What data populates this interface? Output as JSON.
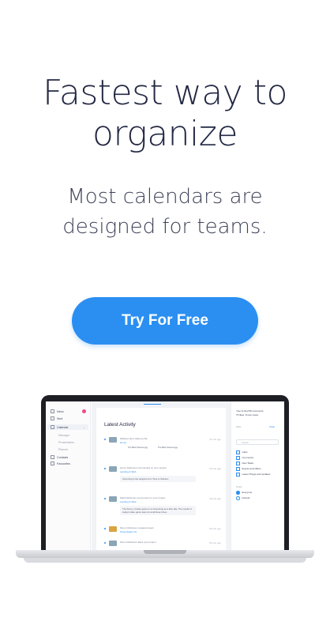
{
  "hero": {
    "title_line1": "Fastest way to",
    "title_line2": "organize",
    "subtitle_line1": "Most calendars are",
    "subtitle_line2": "designed for teams.",
    "cta_label": "Try For Free"
  },
  "colors": {
    "accent": "#2b8ff2",
    "heading": "#232843",
    "badge": "#ef4b86"
  },
  "device": {
    "sidebar": {
      "items": [
        {
          "label": "Inbox",
          "icon": "inbox-icon"
        },
        {
          "label": "Sent",
          "icon": "send-icon"
        },
        {
          "label": "Calendar",
          "icon": "calendar-icon"
        },
        {
          "label": "Manager",
          "sub": true
        },
        {
          "label": "Presentation",
          "sub": true
        },
        {
          "label": "Planner",
          "sub": true
        },
        {
          "label": "Contacts",
          "icon": "contacts-icon"
        },
        {
          "label": "Favourites",
          "icon": "star-icon"
        }
      ]
    },
    "main": {
      "title": "Latest Activity",
      "activities": [
        {
          "line": "Mathew Hine shared a file",
          "link": "Home",
          "time": "11 min ago",
          "files": [
            "The Best Screens.jpg",
            "The Best Screens.jpg"
          ]
        },
        {
          "line": "Henry Robinson commented on your project",
          "link": "Landing & Web",
          "time": "20 min ago",
          "comment": "According to the analysis from Time to Solution"
        },
        {
          "line": "Mark Robinson commented on your project",
          "link": "Landing & Web",
          "time": "40 min ago",
          "comment": "The theory of video game is so interesting as a fairy tale. The results of today's video game was not at all these times."
        },
        {
          "line": "Simon Robinson created project",
          "link": "Presentation Kit",
          "time": "50 min ago"
        },
        {
          "line": "Simon Robinson liked your project",
          "link": "",
          "time": "55 min ago"
        }
      ]
    },
    "right": {
      "note_line1": "Your invited 58 comments,",
      "note_line2": "76 likes, 8 new views",
      "filter_label": "Filter",
      "clear_label": "Clear",
      "search_placeholder": "Search",
      "checks": [
        "Likes",
        "Comments",
        "New Tasks",
        "Events and Offers",
        "Latest Things and Updates"
      ],
      "radio_title": "Posts",
      "radios": [
        "Everyone",
        "Friends"
      ]
    }
  }
}
